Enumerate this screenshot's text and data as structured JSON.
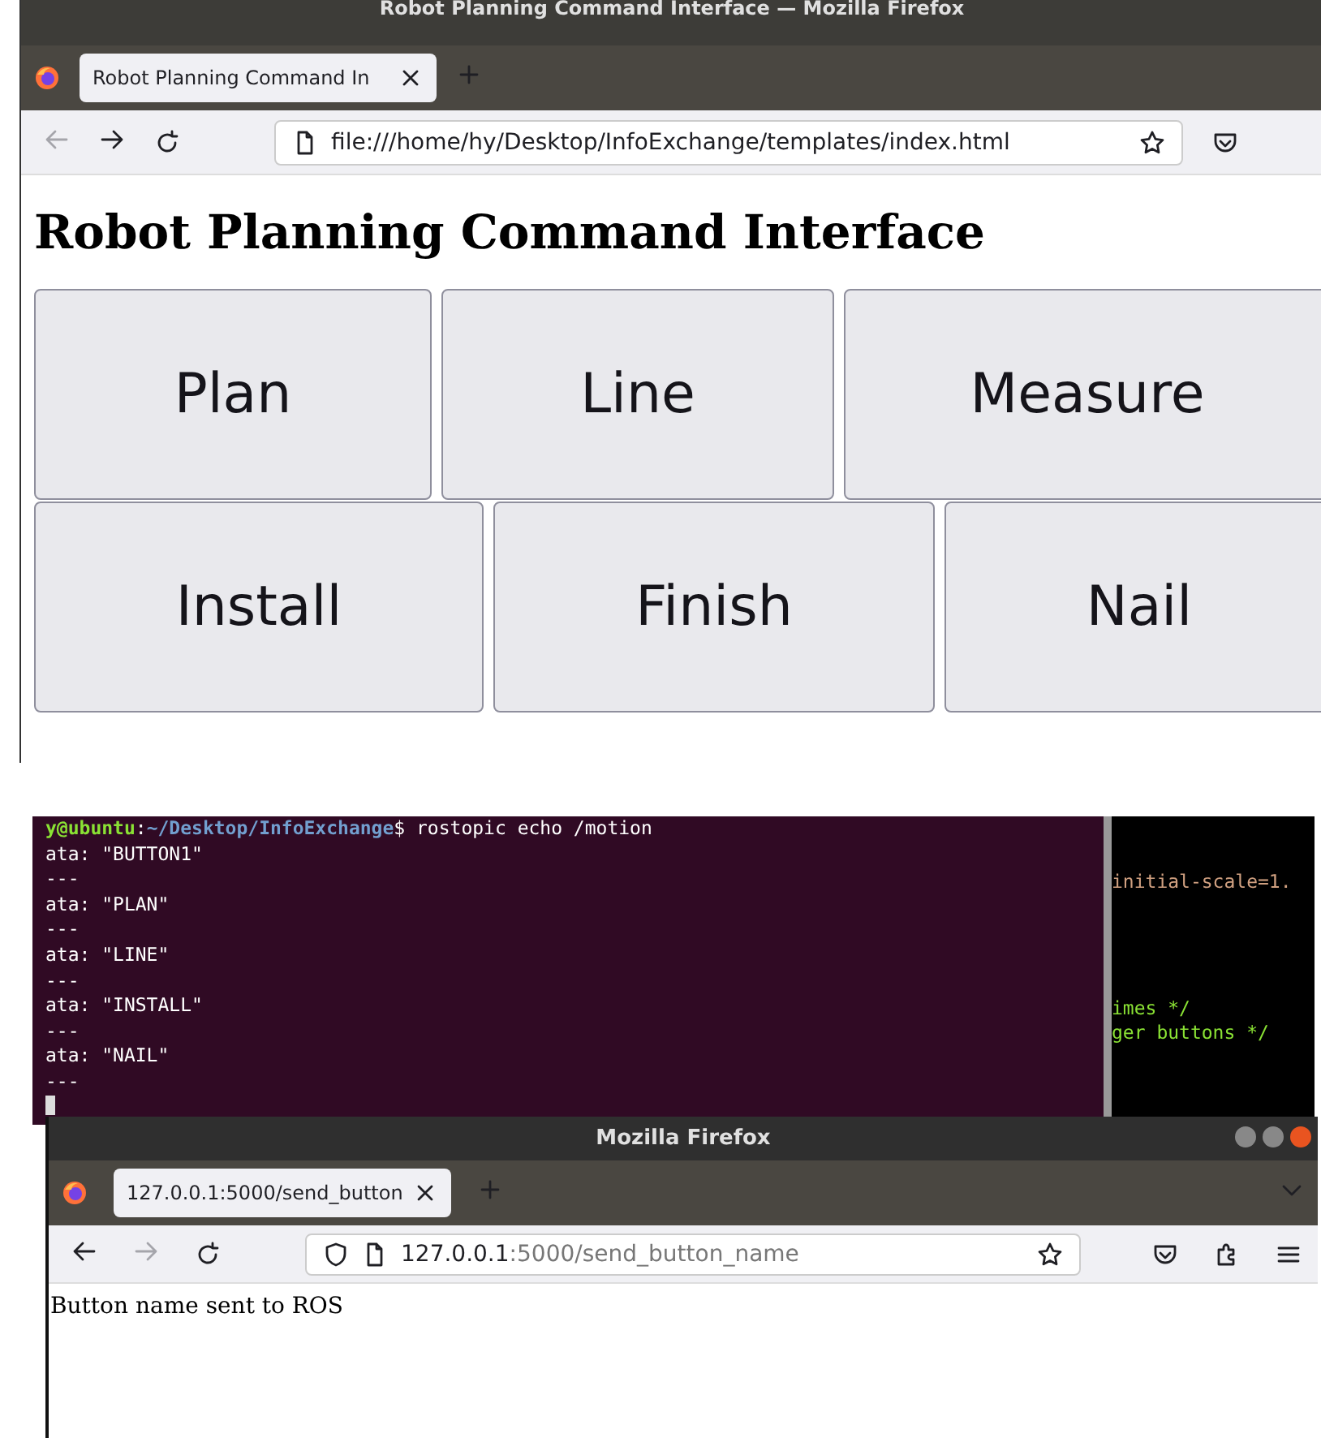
{
  "top_browser": {
    "window_title": "Robot Planning Command Interface — Mozilla Firefox",
    "tab": {
      "label": "Robot Planning Command In",
      "selected": true
    },
    "back_disabled": true,
    "forward_disabled": false,
    "url": "file:///home/hy/Desktop/InfoExchange/templates/index.html",
    "heading": "Robot Planning Command Interface",
    "button_rows": [
      [
        "Plan",
        "Line",
        "Measure"
      ],
      [
        "Install",
        "Finish",
        "Nail"
      ]
    ]
  },
  "terminal": {
    "prompt": {
      "user_host": "y@ubuntu",
      "separator": ":",
      "path": "~/Desktop/InfoExchange",
      "command": "$ rostopic echo /motion"
    },
    "lines": [
      "ata: \"BUTTON1\"",
      "---",
      "ata: \"PLAN\"",
      "---",
      "ata: \"LINE\"",
      "---",
      "ata: \"INSTALL\"",
      "---",
      "ata: \"NAIL\"",
      "---"
    ],
    "editor_lines": [
      {
        "text": "initial-scale=1.",
        "kind": "code"
      },
      {
        "text": "imes */",
        "kind": "comment"
      },
      {
        "text": "ger buttons */",
        "kind": "comment"
      }
    ]
  },
  "bottom_browser": {
    "window_title": "Mozilla Firefox",
    "tab": {
      "label": "127.0.0.1:5000/send_button",
      "selected": true
    },
    "back_disabled": false,
    "forward_disabled": true,
    "url_host": "127.0.0.1",
    "url_rest": ":5000/send_button_name",
    "body_text": "Button name sent to ROS"
  }
}
